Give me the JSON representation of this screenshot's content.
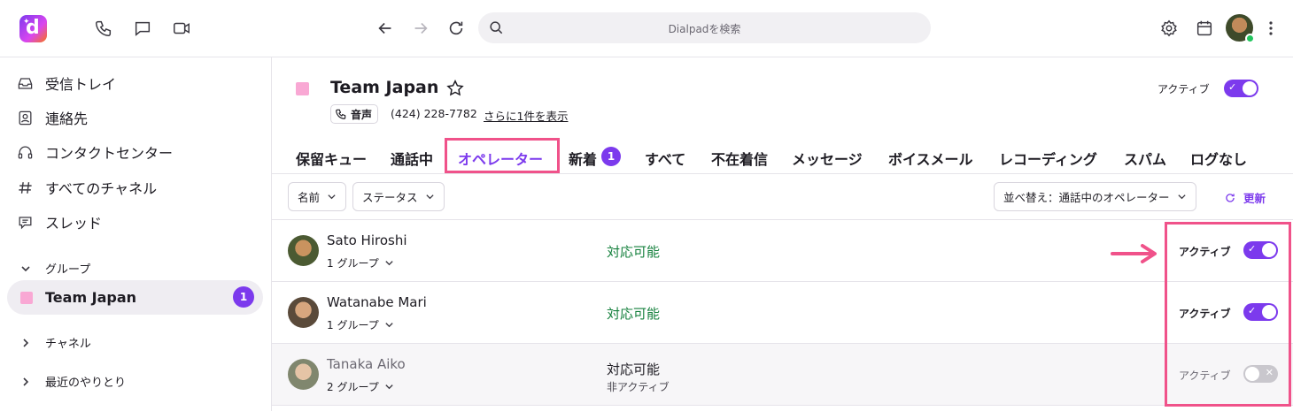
{
  "topbar": {
    "search_placeholder": "Dialpadを検索",
    "icons": [
      "phone-icon",
      "chat-icon",
      "video-icon",
      "back-icon",
      "forward-icon",
      "reload-icon",
      "search-icon",
      "settings-icon",
      "calendar-icon",
      "more-icon"
    ]
  },
  "sidebar": {
    "items": [
      {
        "label": "受信トレイ",
        "icon": "inbox-icon"
      },
      {
        "label": "連絡先",
        "icon": "contacts-icon"
      },
      {
        "label": "コンタクトセンター",
        "icon": "headset-icon"
      },
      {
        "label": "すべてのチャネル",
        "icon": "hash-icon"
      },
      {
        "label": "スレッド",
        "icon": "thread-icon"
      }
    ],
    "groups_label": "グループ",
    "team": {
      "label": "Team Japan",
      "badge": "1"
    },
    "channels_label": "チャネル",
    "recent_label": "最近のやりとり"
  },
  "header": {
    "title": "Team Japan",
    "voice_label": "音声",
    "phone": "(424) 228-7782",
    "more_link": "さらに1件を表示",
    "active_label": "アクティブ",
    "active_on": true
  },
  "tabs": [
    {
      "label": "保留キュー"
    },
    {
      "label": "通話中"
    },
    {
      "label": "オペレーター",
      "selected": true
    },
    {
      "label": "新着",
      "badge": "1"
    },
    {
      "label": "すべて"
    },
    {
      "label": "不在着信"
    },
    {
      "label": "メッセージ"
    },
    {
      "label": "ボイスメール"
    },
    {
      "label": "レコーディング"
    },
    {
      "label": "スパム"
    },
    {
      "label": "ログなし"
    }
  ],
  "filters": {
    "name": "名前",
    "status": "ステータス",
    "sort": "並べ替え：通話中のオペレーター",
    "refresh": "更新"
  },
  "operators": [
    {
      "name": "Sato Hiroshi",
      "groups": "1 グループ",
      "status": "対応可能",
      "active_label": "アクティブ",
      "active": true
    },
    {
      "name": "Watanabe Mari",
      "groups": "1 グループ",
      "status": "対応可能",
      "active_label": "アクティブ",
      "active": true
    },
    {
      "name": "Tanaka Aiko",
      "groups": "2 グループ",
      "status": "対応可能",
      "sub_status": "非アクティブ",
      "active_label": "アクティブ",
      "active": false
    }
  ],
  "colors": {
    "accent": "#7c3aed",
    "highlight": "#f0528a",
    "available": "#15803d",
    "team": "#f9a8d4"
  }
}
